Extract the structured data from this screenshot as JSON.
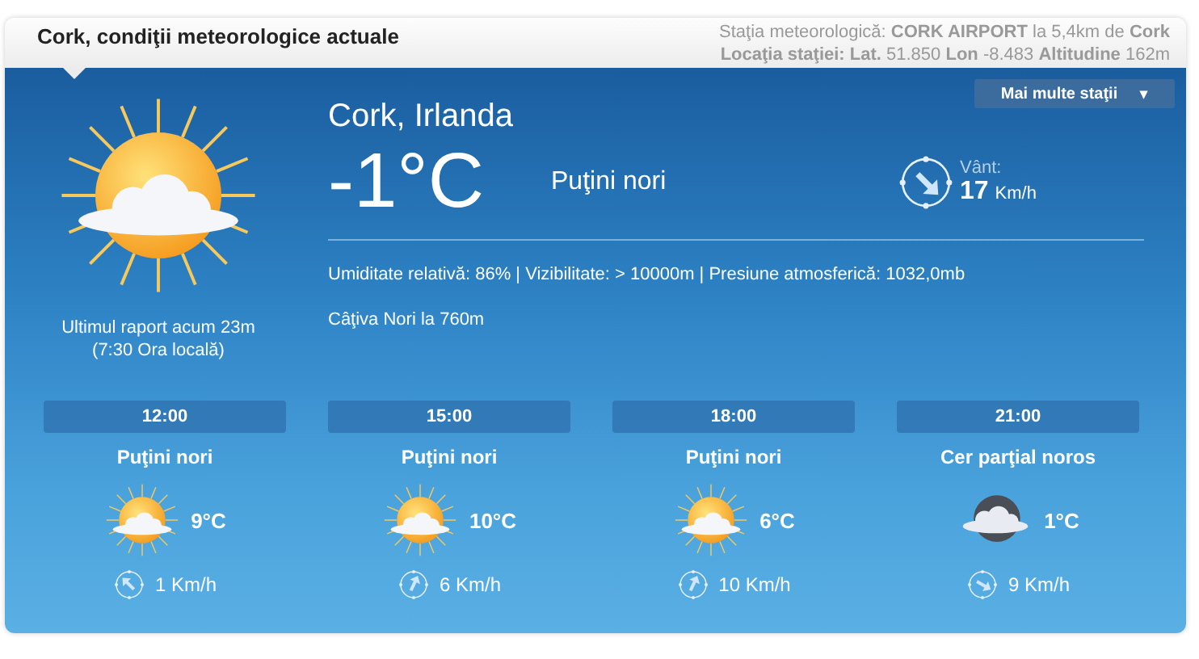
{
  "header": {
    "title": "Cork, condiţii meteorologice actuale",
    "station_line": "Staţia meteorologică: **CORK AIRPORT** la 5,4km de **Cork**",
    "location_line": "**Locaţia staţiei: Lat.** 51.850 **Lon** -8.483 **Altitudine** 162m"
  },
  "stations_dropdown": {
    "label": "Mai multe staţii",
    "caret": "▾"
  },
  "current": {
    "report": "Ultimul raport acum 23m",
    "local_time": "(7:30 Ora locală)",
    "city": "Cork, Irlanda",
    "temperature": "-1°C",
    "condition": "Puţini nori",
    "wind_label": "Vânt:",
    "wind_speed": "17",
    "wind_unit": "Km/h",
    "details": "Umiditate relativă: 86% | Vizibilitate: > 10000m | Presiune atmosferică: 1032,0mb",
    "clouds": "Câţiva Nori la 760m"
  },
  "forecast": [
    {
      "kind": "day",
      "time": "12:00",
      "condition": "Puţini nori",
      "temperature": "9°C",
      "wind": "1 Km/h"
    },
    {
      "kind": "day",
      "time": "15:00",
      "condition": "Puţini nori",
      "temperature": "10°C",
      "wind": "6 Km/h"
    },
    {
      "kind": "day",
      "time": "18:00",
      "condition": "Puţini nori",
      "temperature": "6°C",
      "wind": "10 Km/h"
    },
    {
      "kind": "night",
      "time": "21:00",
      "condition": "Cer parţial noros",
      "temperature": "1°C",
      "wind": "9 Km/h"
    }
  ]
}
